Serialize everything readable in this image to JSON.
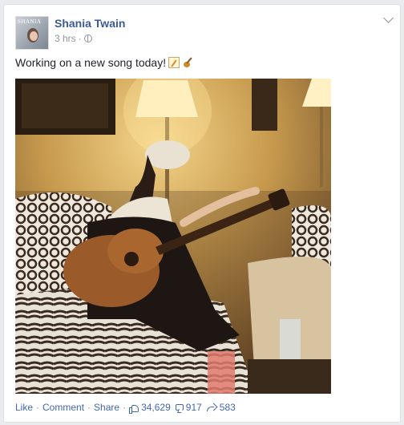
{
  "post": {
    "author": "Shania Twain",
    "avatar_text": "SHANIA",
    "time": "3 hrs",
    "separator": "·",
    "text": "Working on a new song today!",
    "emojis": [
      "memo-icon",
      "guitar-icon"
    ]
  },
  "actions": {
    "like": "Like",
    "comment": "Comment",
    "share": "Share",
    "separator": "·"
  },
  "stats": {
    "likes": "34,629",
    "comments": "917",
    "shares": "583"
  },
  "colors": {
    "link": "#3b5998",
    "action_link": "#4267b2",
    "meta": "#90949c",
    "text": "#1d2129"
  }
}
